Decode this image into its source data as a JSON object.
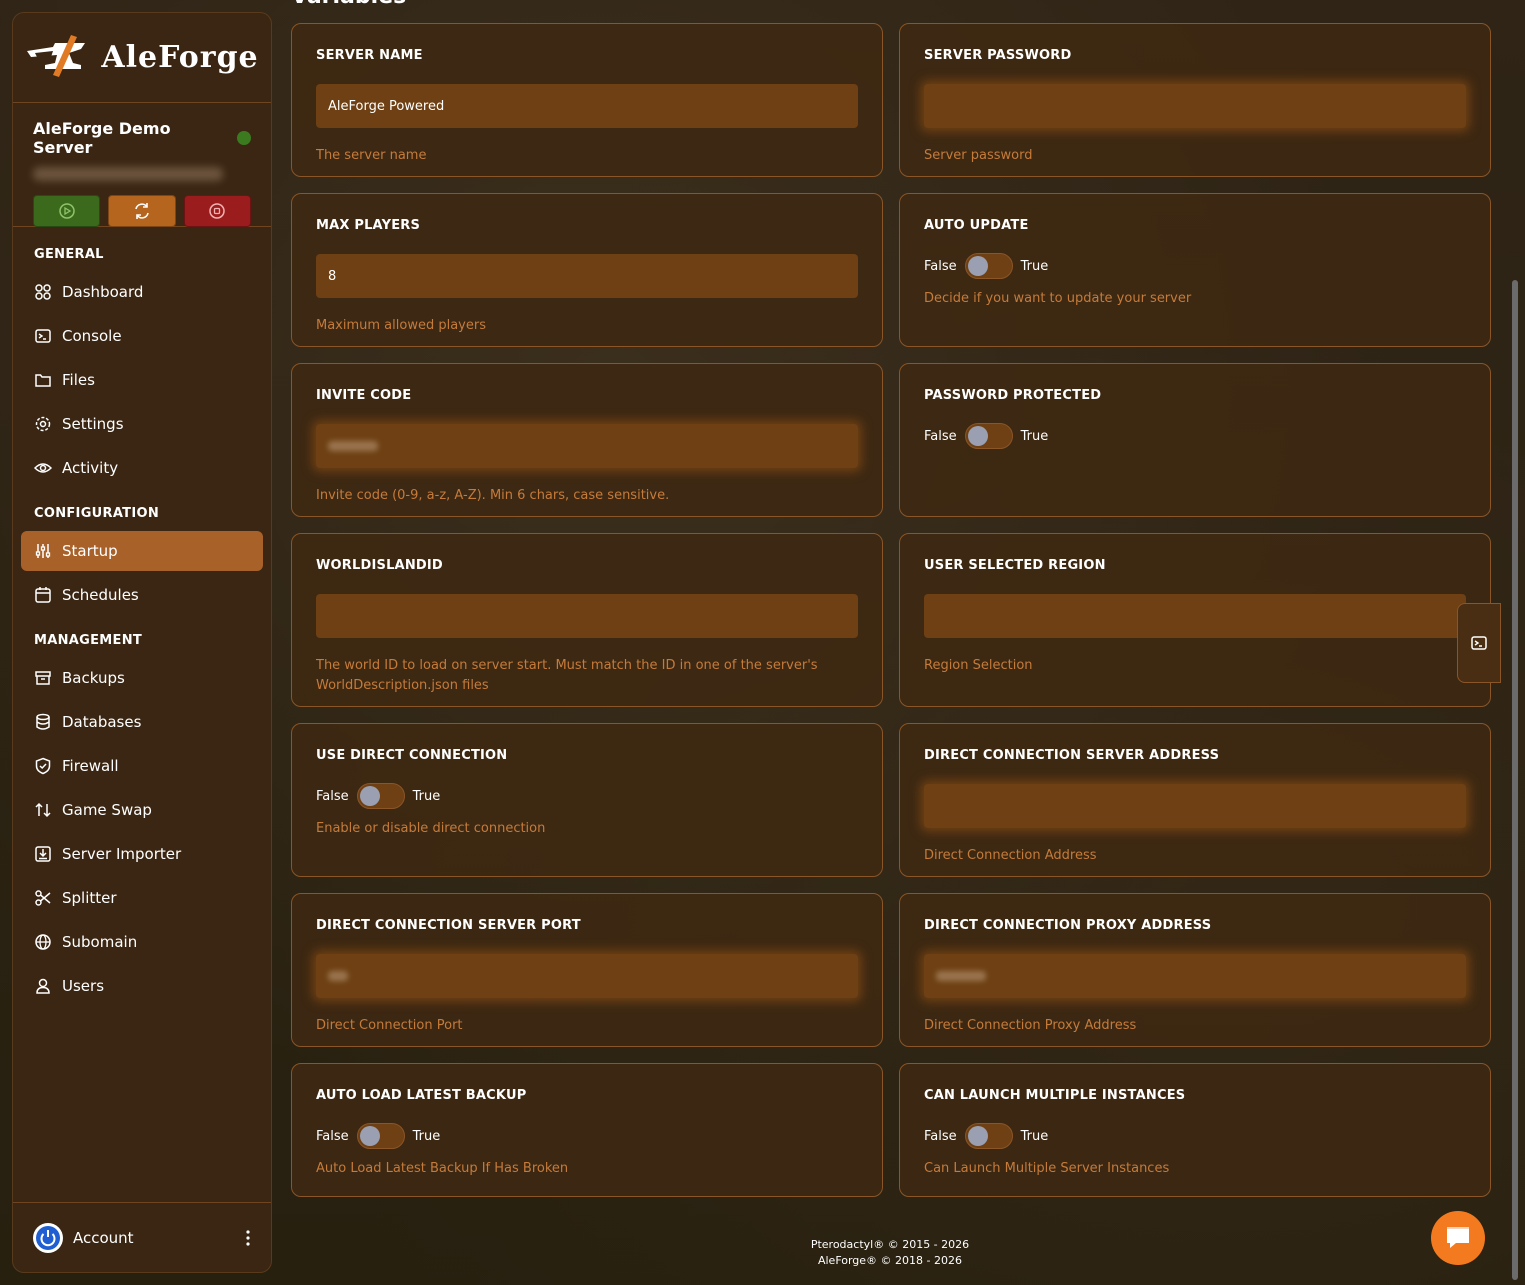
{
  "brand": {
    "logo_text": "AleForge"
  },
  "server": {
    "name": "AleForge Demo Server",
    "status_color": "#3b7a1f"
  },
  "power": {
    "start_icon": "play-icon",
    "restart_icon": "refresh-icon",
    "stop_icon": "stop-icon"
  },
  "nav": {
    "general_label": "GENERAL",
    "configuration_label": "CONFIGURATION",
    "management_label": "MANAGEMENT",
    "dashboard": "Dashboard",
    "console": "Console",
    "files": "Files",
    "settings": "Settings",
    "activity": "Activity",
    "startup": "Startup",
    "schedules": "Schedules",
    "backups": "Backups",
    "databases": "Databases",
    "firewall": "Firewall",
    "game_swap": "Game Swap",
    "server_importer": "Server Importer",
    "splitter": "Splitter",
    "subdomain": "Subomain",
    "users": "Users"
  },
  "account": {
    "label": "Account"
  },
  "page": {
    "heading": "Variables"
  },
  "toggle": {
    "false_label": "False",
    "true_label": "True"
  },
  "variables": {
    "server_name": {
      "title": "SERVER NAME",
      "value": "AleForge Powered",
      "help": "The server name"
    },
    "server_password": {
      "title": "SERVER PASSWORD",
      "help": "Server password"
    },
    "max_players": {
      "title": "MAX PLAYERS",
      "value": "8",
      "help": "Maximum allowed players"
    },
    "auto_update": {
      "title": "AUTO UPDATE",
      "value": false,
      "help": "Decide if you want to update your server"
    },
    "invite_code": {
      "title": "INVITE CODE",
      "help": "Invite code (0-9, a-z, A-Z). Min 6 chars, case sensitive."
    },
    "password_protected": {
      "title": "PASSWORD PROTECTED",
      "value": false
    },
    "world_island_id": {
      "title": "WORLDISLANDID",
      "value": "",
      "help": "The world ID to load on server start. Must match the ID in one of the server's WorldDescription.json files"
    },
    "user_selected_region": {
      "title": "USER SELECTED REGION",
      "value": "",
      "help": "Region Selection"
    },
    "use_direct_connection": {
      "title": "USE DIRECT CONNECTION",
      "value": false,
      "help": "Enable or disable direct connection"
    },
    "direct_connection_server_address": {
      "title": "DIRECT CONNECTION SERVER ADDRESS",
      "help": "Direct Connection Address"
    },
    "direct_connection_server_port": {
      "title": "DIRECT CONNECTION SERVER PORT",
      "help": "Direct Connection Port"
    },
    "direct_connection_proxy_address": {
      "title": "DIRECT CONNECTION PROXY ADDRESS",
      "help": "Direct Connection Proxy Address"
    },
    "auto_load_latest_backup": {
      "title": "AUTO LOAD LATEST BACKUP",
      "value": false,
      "help": "Auto Load Latest Backup If Has Broken"
    },
    "can_launch_multiple_instances": {
      "title": "CAN LAUNCH MULTIPLE INSTANCES",
      "value": false,
      "help": "Can Launch Multiple Server Instances"
    }
  },
  "footer": {
    "line1": "Pterodactyl® © 2015 - 2026",
    "line2": "AleForge® © 2018 - 2026"
  },
  "colors": {
    "accent": "#a86128",
    "help_text": "#c57b3a",
    "input_bg": "#6e4013",
    "card_border": "#8a5527",
    "chat_button": "#f47a1f"
  }
}
